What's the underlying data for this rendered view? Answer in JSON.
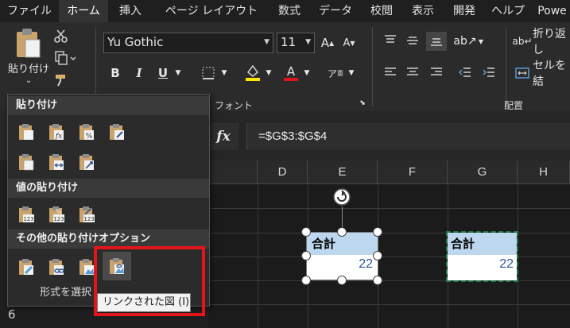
{
  "menu": {
    "tabs": [
      {
        "label": "ファイル"
      },
      {
        "label": "ホーム"
      },
      {
        "label": "挿入"
      },
      {
        "label": "ページ レイアウト"
      },
      {
        "label": "数式"
      },
      {
        "label": "データ"
      },
      {
        "label": "校閲"
      },
      {
        "label": "表示"
      },
      {
        "label": "開発"
      },
      {
        "label": "ヘルプ"
      },
      {
        "label": "Powe"
      }
    ]
  },
  "ribbon": {
    "paste_label": "貼り付け",
    "font": {
      "name": "Yu Gothic",
      "size": "11",
      "group_label": "フォント",
      "bold": "B",
      "italic": "I",
      "underline": "U"
    },
    "alignment": {
      "group_label": "配置",
      "wrap_text": "折り返し",
      "merge": "セルを結"
    },
    "colors": {
      "highlight": "#ffe600",
      "font_color": "#e3141a"
    }
  },
  "formula_bar": {
    "fx_label": "fx",
    "formula": "=$G$3:$G$4"
  },
  "grid": {
    "columns": [
      "D",
      "E",
      "F",
      "G",
      "H"
    ],
    "visible_row_numbers": [
      "6"
    ]
  },
  "picture": {
    "header": "合計",
    "value": "22"
  },
  "copy_source": {
    "header": "合計",
    "value": "22"
  },
  "paste_menu": {
    "sections": [
      {
        "title": "貼り付け"
      },
      {
        "title": "値の貼り付け"
      },
      {
        "title": "その他の貼り付けオプション"
      }
    ],
    "footer": "形式を選択",
    "tooltip": "リンクされた図 (I)",
    "icons": [
      "paste-icon",
      "paste-formulas-icon",
      "paste-formulas-number-format-icon",
      "keep-source-formatting-icon",
      "no-borders-icon",
      "keep-column-widths-icon",
      "transpose-icon",
      "values-icon",
      "values-number-format-icon",
      "values-source-formatting-icon",
      "formatting-icon",
      "paste-link-icon",
      "picture-icon",
      "linked-picture-icon"
    ]
  }
}
